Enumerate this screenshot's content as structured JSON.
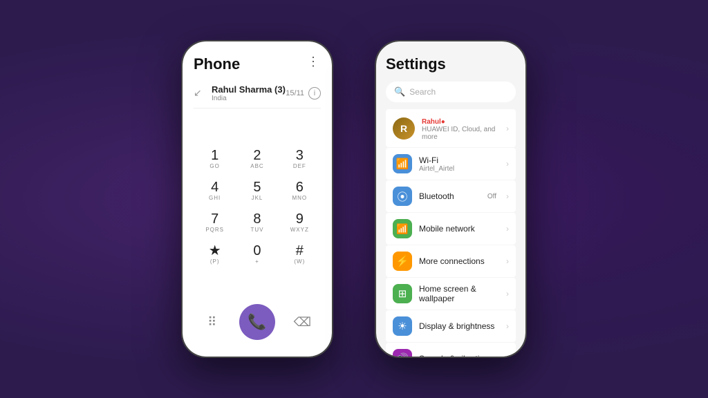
{
  "phone": {
    "title": "Phone",
    "menu_dots": "⋮",
    "contact": {
      "name": "Rahul Sharma (3)",
      "country": "India",
      "count": "15/11"
    },
    "dialpad": [
      [
        {
          "num": "1",
          "letters": "GO"
        },
        {
          "num": "2",
          "letters": "ABC"
        },
        {
          "num": "3",
          "letters": "DEF"
        }
      ],
      [
        {
          "num": "4",
          "letters": "GHI"
        },
        {
          "num": "5",
          "letters": "JKL"
        },
        {
          "num": "6",
          "letters": "MNO"
        }
      ],
      [
        {
          "num": "7",
          "letters": "PQRS"
        },
        {
          "num": "8",
          "letters": "TUV"
        },
        {
          "num": "9",
          "letters": "WXYZ"
        }
      ],
      [
        {
          "num": "★",
          "letters": "(P)"
        },
        {
          "num": "0",
          "letters": "+"
        },
        {
          "num": "#",
          "letters": "(W)"
        }
      ]
    ],
    "bottom_icons": [
      "grid",
      "call",
      "backspace"
    ]
  },
  "settings": {
    "title": "Settings",
    "search_placeholder": "Search",
    "profile": {
      "name": "Rahul",
      "dot": "●",
      "subtitle": "HUAWEI ID, Cloud, and more"
    },
    "items": [
      {
        "icon": "📶",
        "icon_class": "s-icon-wifi",
        "label": "Wi-Fi",
        "value": "Airtel_Airtel"
      },
      {
        "icon": "🔵",
        "icon_class": "s-icon-bt",
        "label": "Bluetooth",
        "value": "Off"
      },
      {
        "icon": "📱",
        "icon_class": "s-icon-mobile",
        "label": "Mobile network",
        "value": ""
      },
      {
        "icon": "🔗",
        "icon_class": "s-icon-conn",
        "label": "More connections",
        "value": ""
      },
      {
        "icon": "🏠",
        "icon_class": "s-icon-home",
        "label": "Home screen & wallpaper",
        "value": ""
      },
      {
        "icon": "☀",
        "icon_class": "s-icon-display",
        "label": "Display & brightness",
        "value": ""
      },
      {
        "icon": "🔊",
        "icon_class": "s-icon-sound",
        "label": "Sounds & vibration",
        "value": ""
      }
    ]
  }
}
